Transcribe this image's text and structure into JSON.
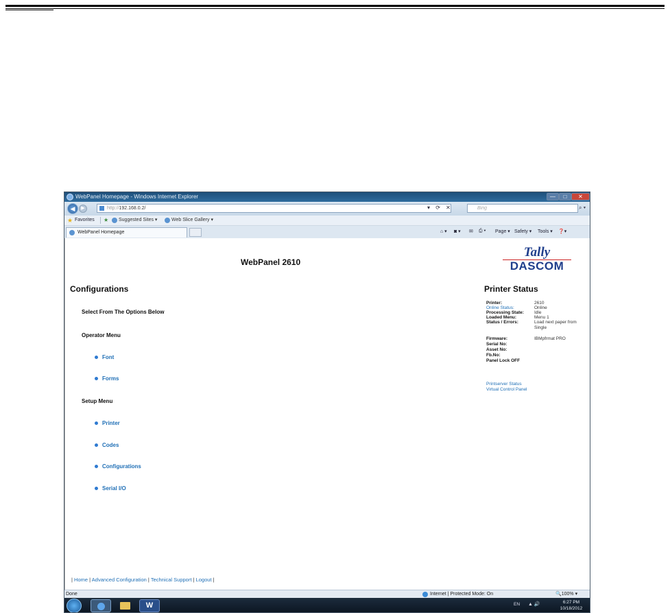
{
  "window": {
    "title": "WebPanel Homepage - Windows Internet Explorer",
    "min_glyph": "—",
    "max_glyph": "□",
    "close_glyph": "✕"
  },
  "address_bar": {
    "url_prefix": "http://",
    "url": "192.168.0.2/",
    "search_placeholder": "Bing"
  },
  "favorites_bar": {
    "label": "Favorites",
    "suggested_sites": "Suggested Sites ▾",
    "web_slice_gallery": "Web Slice Gallery ▾"
  },
  "tab": {
    "label": "WebPanel Homepage"
  },
  "command_bar": {
    "page": "Page ▾",
    "safety": "Safety ▾",
    "tools": "Tools ▾",
    "help": "❓▾"
  },
  "page": {
    "title": "WebPanel 2610",
    "logo": {
      "tally": "Tally",
      "dascom": "DASCOM"
    },
    "configurations_heading": "Configurations",
    "select_options": "Select From The Options Below",
    "operator_menu": {
      "label": "Operator Menu",
      "items": [
        "Font",
        "Forms"
      ]
    },
    "setup_menu": {
      "label": "Setup Menu",
      "items": [
        "Printer",
        "Codes",
        "Configurations",
        "Serial I/O"
      ]
    },
    "printer_status": {
      "heading": "Printer Status",
      "printer_label": "Printer:",
      "printer_value": "2610",
      "online_label": "Online Status:",
      "online_value": "Online",
      "processing_label": "Processing State:",
      "processing_value": "Idle",
      "loaded_menu_label": "Loaded Menu:",
      "loaded_menu_value": "Menu 1",
      "status_label": "Status / Errors:",
      "status_value_1": "Load next paper from",
      "status_value_2": "Single",
      "firmware_label": "Firmware:",
      "firmware_value": "IBMpfrmat PRO",
      "serial_label": "Serial No:",
      "asset_label": "Asset No:",
      "fb_label": "Fb.No:",
      "panel_lock": "Panel Lock OFF",
      "printserver_link": "Printserver Status",
      "vcp_link": "Virtual Control Panel"
    },
    "footer": {
      "home": "Home",
      "advanced": "Advanced Configuration",
      "support": "Technical Support",
      "logout": "Logout"
    }
  },
  "status_bar": {
    "left": "Done",
    "zone": "Internet | Protected Mode: On",
    "zoom": "🔍100% ▾"
  },
  "taskbar": {
    "word_glyph": "W",
    "lang": "EN",
    "time": "6:27 PM",
    "date": "10/18/2012"
  }
}
